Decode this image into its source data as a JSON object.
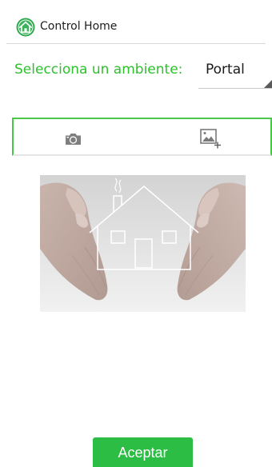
{
  "app": {
    "title": "Control Home",
    "icon": "green-house-icon"
  },
  "ambient": {
    "label": "Selecciona un ambiente:",
    "selected": "Portal"
  },
  "tabs": [
    {
      "icon": "camera-icon"
    },
    {
      "icon": "add-image-icon"
    }
  ],
  "photo": {
    "description": "hands-around-house-image"
  },
  "actions": {
    "accept_label": "Aceptar"
  },
  "colors": {
    "accent": "#2ec02e",
    "button": "#2bbd44",
    "tab_border": "#48c948"
  }
}
